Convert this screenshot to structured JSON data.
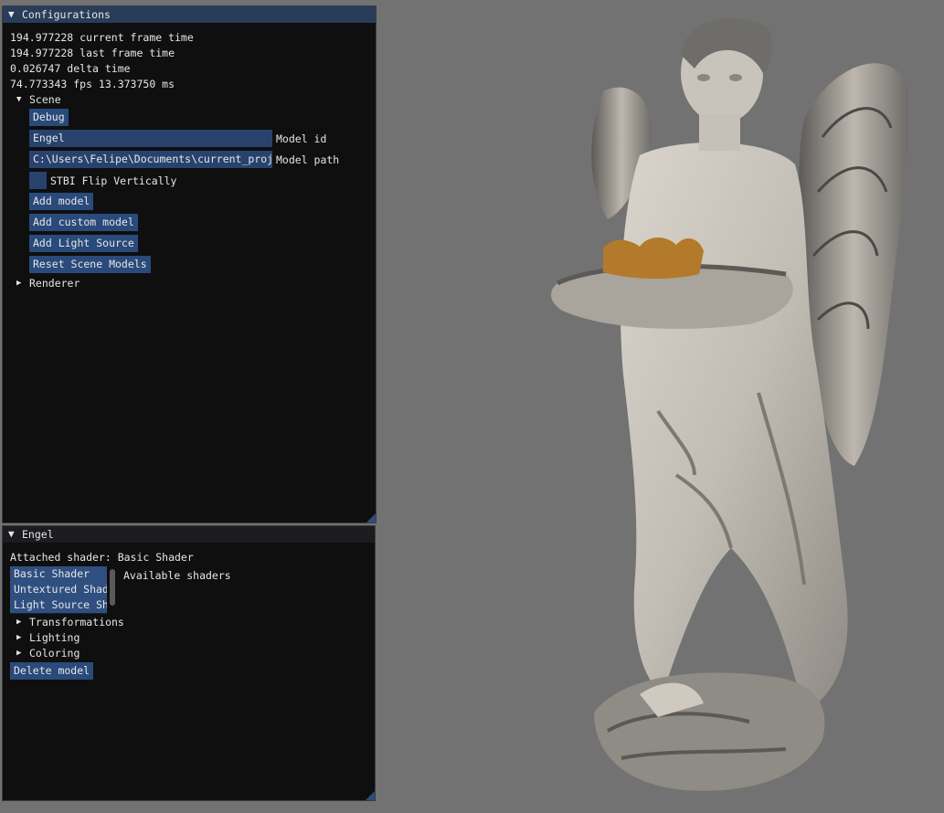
{
  "config_window": {
    "title": "Configurations",
    "stats": [
      "194.977228 current frame time",
      "194.977228 last frame time",
      "0.026747 delta time",
      "74.773343 fps 13.373750 ms"
    ],
    "scene": {
      "header": "Scene",
      "debug_button": "Debug",
      "model_id_value": "Engel",
      "model_id_label": "Model id",
      "model_path_value": "C:\\Users\\Felipe\\Documents\\current_proj",
      "model_path_label": "Model path",
      "flip_label": "STBI Flip Vertically",
      "flip_checked": false,
      "add_model": "Add model",
      "add_custom_model": "Add custom model",
      "add_light_source": "Add Light Source",
      "reset_scene_models": "Reset Scene Models"
    },
    "renderer_header": "Renderer"
  },
  "model_window": {
    "title": "Engel",
    "attached_shader": "Attached shader: Basic Shader",
    "shaders": [
      "Basic Shader",
      "Untextured Shader",
      "Light Source Shader"
    ],
    "selected_shader": "Basic Shader",
    "available_label": "Available shaders",
    "sections": [
      "Transformations",
      "Lighting",
      "Coloring"
    ],
    "delete_button": "Delete model"
  },
  "viewport": {
    "background_color": "#727272",
    "subject": "angel-statue"
  }
}
